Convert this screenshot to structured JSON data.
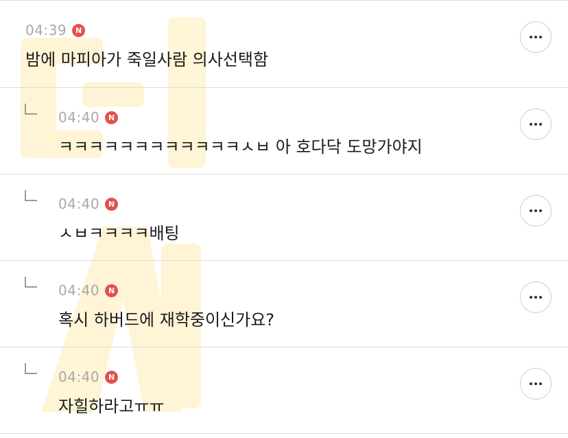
{
  "comments": [
    {
      "time": "04:39",
      "badge": "N",
      "text": "밤에 마피아가 죽일사람 의사선택함",
      "reply": false
    },
    {
      "time": "04:40",
      "badge": "N",
      "text": "ㅋㅋㅋㅋㅋㅋㅋㅋㅋㅋㅋㅋㅅㅂ 아 호다닥 도망가야지",
      "reply": true
    },
    {
      "time": "04:40",
      "badge": "N",
      "text": "ㅅㅂㅋㅋㅋㅋ배팅",
      "reply": true
    },
    {
      "time": "04:40",
      "badge": "N",
      "text": "혹시 하버드에 재학중이신가요?",
      "reply": true
    },
    {
      "time": "04:40",
      "badge": "N",
      "text": "자힐하라고ㅠㅠ",
      "reply": true
    }
  ],
  "icons": {
    "more": "more-horizontal-icon",
    "reply": "reply-arrow-icon"
  },
  "colors": {
    "badge": "#e5504b",
    "watermark": "#ffd24a",
    "divider": "#dcdcdc"
  }
}
